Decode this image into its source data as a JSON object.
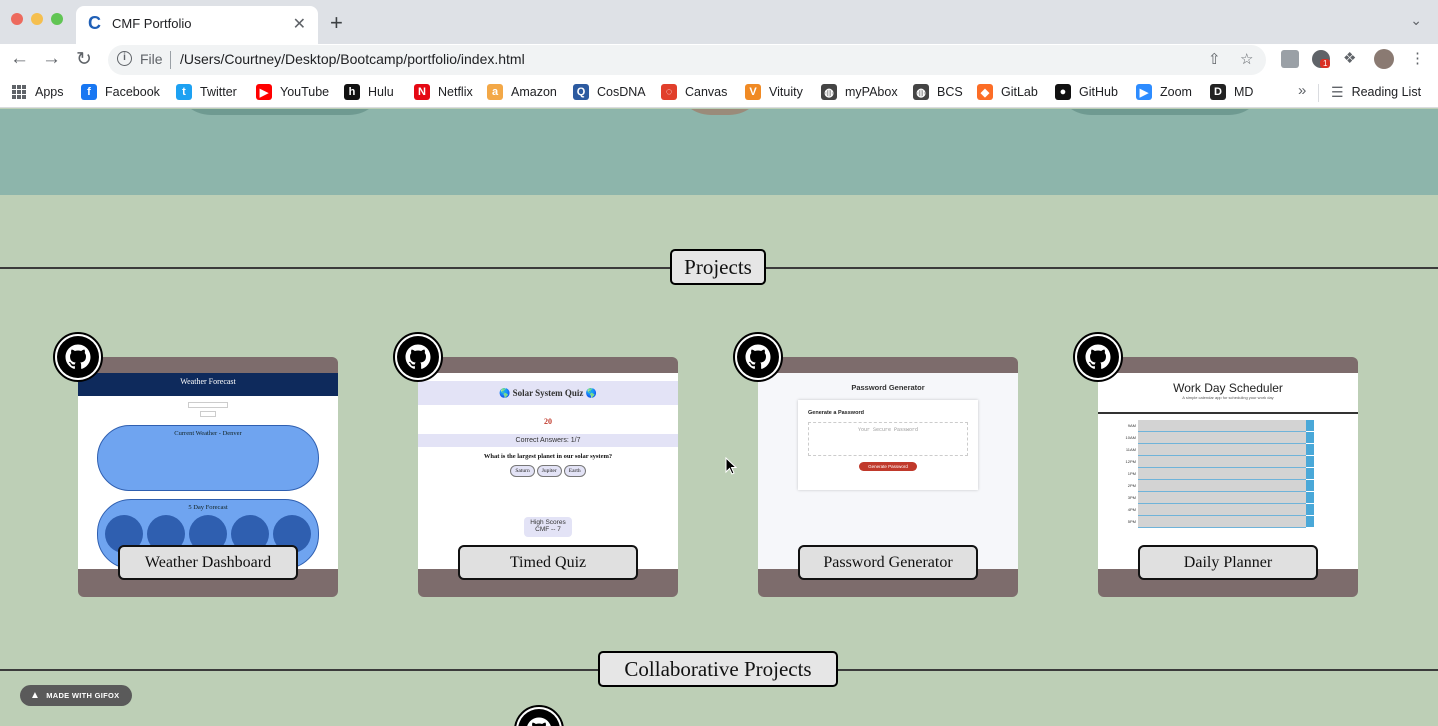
{
  "browser": {
    "tab_title": "CMF Portfolio",
    "tab_favicon": "C",
    "tab_close": "✕",
    "new_tab": "+",
    "file_label": "File",
    "url": "/Users/Courtney/Desktop/Bootcamp/portfolio/index.html",
    "extension_badge": "1"
  },
  "bookmarks": {
    "apps": "Apps",
    "items": [
      {
        "label": "Facebook",
        "icon": "facebook-icon",
        "color": "#1877f2",
        "glyph": "f"
      },
      {
        "label": "Twitter",
        "icon": "twitter-icon",
        "color": "#1da1f2",
        "glyph": "t"
      },
      {
        "label": "YouTube",
        "icon": "youtube-icon",
        "color": "#ff0000",
        "glyph": "▶"
      },
      {
        "label": "Hulu",
        "icon": "hulu-icon",
        "color": "#111111",
        "glyph": "h"
      },
      {
        "label": "Netflix",
        "icon": "netflix-icon",
        "color": "#e50914",
        "glyph": "N"
      },
      {
        "label": "Amazon",
        "icon": "amazon-icon",
        "color": "#f3a847",
        "glyph": "a"
      },
      {
        "label": "CosDNA",
        "icon": "cosdna-icon",
        "color": "#2c5aa0",
        "glyph": "Q"
      },
      {
        "label": "Canvas",
        "icon": "canvas-icon",
        "color": "#e13f2b",
        "glyph": "◌"
      },
      {
        "label": "Vituity",
        "icon": "vituity-icon",
        "color": "#f08a24",
        "glyph": "V"
      },
      {
        "label": "myPAbox",
        "icon": "globe-icon",
        "color": "#444444",
        "glyph": "◍"
      },
      {
        "label": "BCS",
        "icon": "globe-icon",
        "color": "#444444",
        "glyph": "◍"
      },
      {
        "label": "GitLab",
        "icon": "gitlab-icon",
        "color": "#fc6d26",
        "glyph": "◆"
      },
      {
        "label": "GitHub",
        "icon": "github-icon",
        "color": "#111111",
        "glyph": "●"
      },
      {
        "label": "Zoom",
        "icon": "zoom-icon",
        "color": "#2d8cff",
        "glyph": "▶"
      },
      {
        "label": "MD",
        "icon": "md-icon",
        "color": "#222222",
        "glyph": "D"
      }
    ],
    "more": "»",
    "reading_list": "Reading List"
  },
  "page": {
    "projects_heading": "Projects",
    "collab_heading": "Collaborative Projects",
    "projects": [
      {
        "title": "Weather Dashboard",
        "preview_title": "Weather Forecast",
        "preview_sub": "Current Weather - Denver",
        "preview_sub2": "5 Day Forecast"
      },
      {
        "title": "Timed Quiz",
        "preview_title": "Solar System Quiz",
        "preview_score": "20",
        "preview_correct": "Correct Answers: 1/7",
        "preview_question": "What is the largest planet in our solar system?",
        "preview_options": [
          "Saturn",
          "Jupiter",
          "Earth"
        ],
        "preview_high": "High Scores",
        "preview_high_val": "CMF -- 7"
      },
      {
        "title": "Password Generator",
        "preview_title": "Password Generator",
        "preview_sub": "Generate a Password",
        "preview_placeholder": "Your Secure Password",
        "preview_btn": "Generate Password"
      },
      {
        "title": "Daily Planner",
        "preview_title": "Work Day Scheduler",
        "preview_sub": "A simple calendar app for scheduling your work day",
        "preview_hours": [
          "9AM",
          "10AM",
          "11AM",
          "12PM",
          "1PM",
          "2PM",
          "3PM",
          "4PM",
          "5PM"
        ]
      }
    ]
  },
  "watermark": "MADE WITH GIFOX",
  "colors": {
    "page_bg": "#bdcfb6",
    "hero_bg": "#8db5ab",
    "card_bg": "#7d6c6c"
  }
}
